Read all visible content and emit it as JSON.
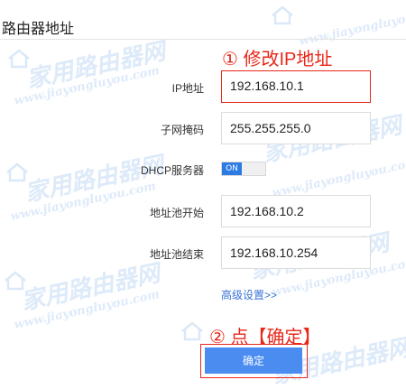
{
  "page": {
    "title": "路由器地址"
  },
  "annotations": {
    "step1": "① 修改IP地址",
    "step2": "② 点【确定】"
  },
  "form": {
    "ip": {
      "label": "IP地址",
      "value": "192.168.10.1"
    },
    "subnet": {
      "label": "子网掩码",
      "value": "255.255.255.0"
    },
    "dhcp": {
      "label": "DHCP服务器",
      "state": "ON"
    },
    "pool_start": {
      "label": "地址池开始",
      "value": "192.168.10.2"
    },
    "pool_end": {
      "label": "地址池结束",
      "value": "192.168.10.254"
    },
    "advanced_link": "高级设置>>",
    "confirm": "确定"
  },
  "watermark": {
    "main": "家用路由器网",
    "site": "www.jiayongluyou.com"
  },
  "colors": {
    "accent_blue": "#4a8cf0",
    "annotation_red": "#e8281a",
    "link_blue": "#3a73d6"
  }
}
